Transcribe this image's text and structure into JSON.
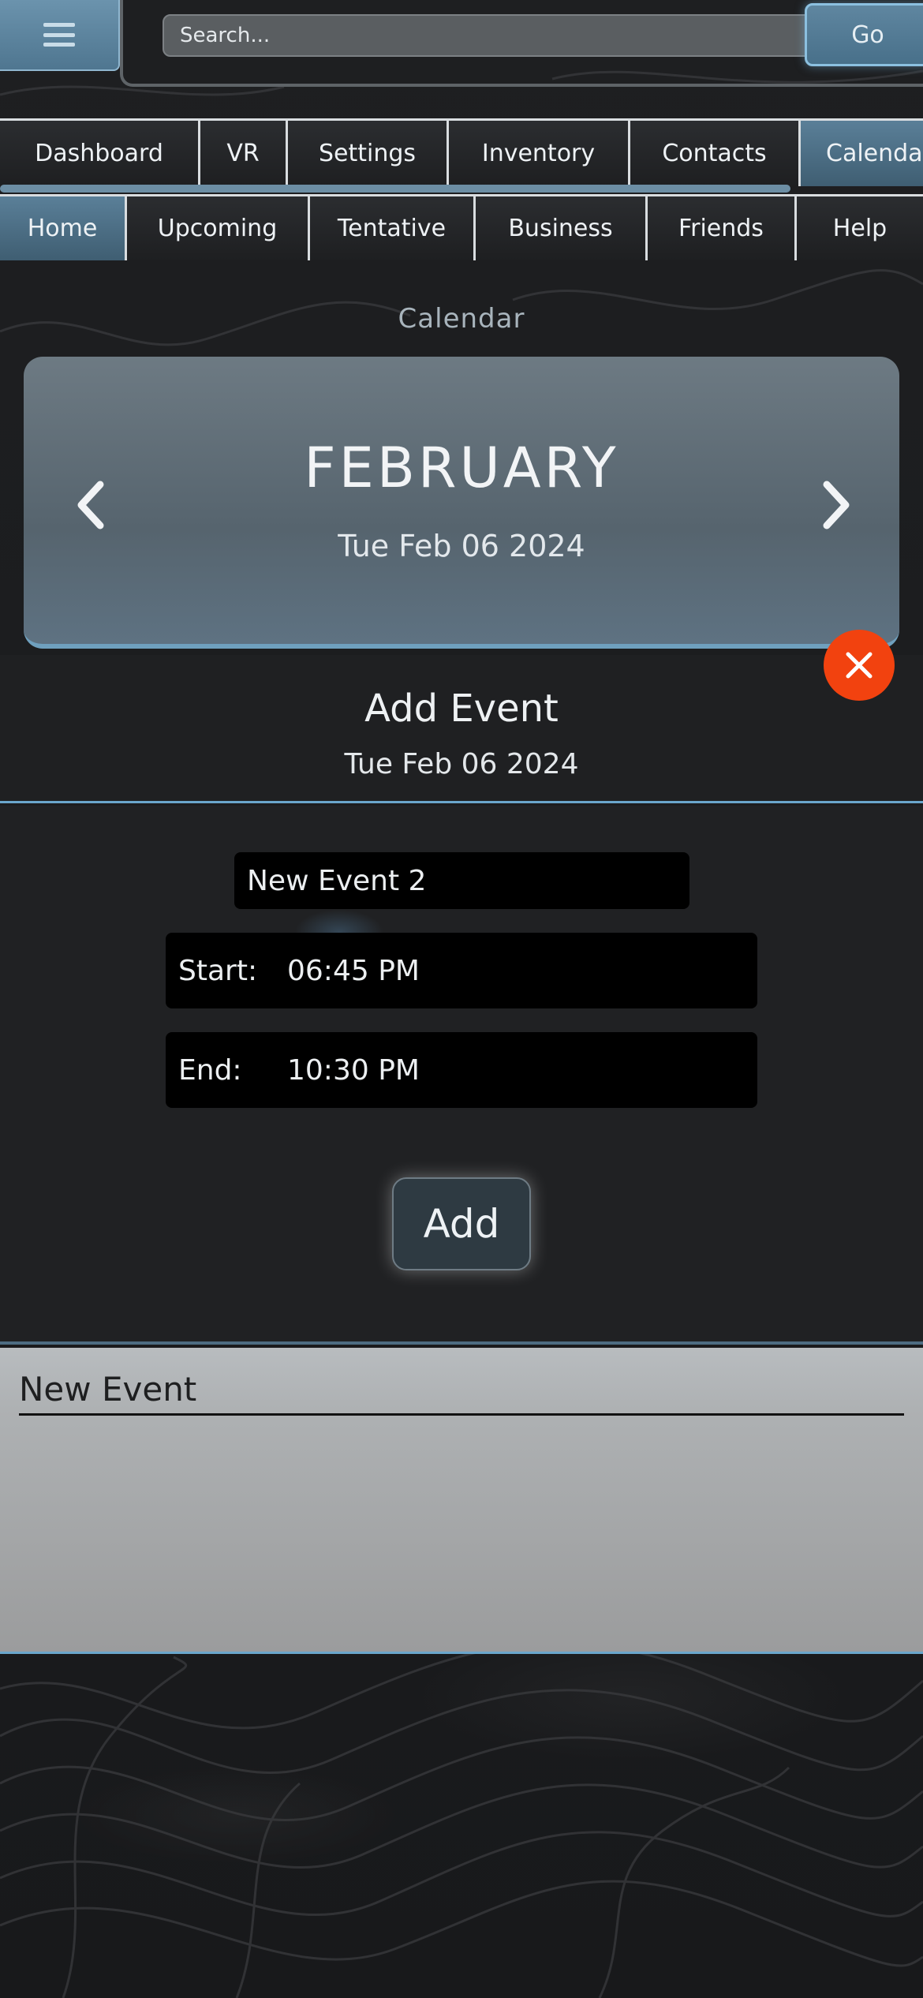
{
  "header": {
    "menu_icon": "hamburger-icon",
    "search_placeholder": "Search...",
    "go_label": "Go"
  },
  "nav_primary": [
    {
      "label": "Dashboard",
      "active": false
    },
    {
      "label": "VR",
      "active": false
    },
    {
      "label": "Settings",
      "active": false
    },
    {
      "label": "Inventory",
      "active": false
    },
    {
      "label": "Contacts",
      "active": false
    },
    {
      "label": "Calendar",
      "active": true
    }
  ],
  "nav_secondary": [
    {
      "label": "Home",
      "active": true
    },
    {
      "label": "Upcoming",
      "active": false
    },
    {
      "label": "Tentative",
      "active": false
    },
    {
      "label": "Business",
      "active": false
    },
    {
      "label": "Friends",
      "active": false
    },
    {
      "label": "Help",
      "active": false
    }
  ],
  "page": {
    "section_title": "Calendar"
  },
  "month_panel": {
    "month": "FEBRUARY",
    "date": "Tue Feb 06 2024",
    "prev_icon": "chevron-left-icon",
    "next_icon": "chevron-right-icon"
  },
  "add_event": {
    "title": "Add Event",
    "date": "Tue Feb 06 2024",
    "close_icon": "close-icon",
    "name_value": "New Event 2",
    "start_label": "Start:",
    "start_value": "06:45 PM",
    "end_label": "End:",
    "end_value": "10:30 PM",
    "add_label": "Add"
  },
  "events": {
    "items": [
      {
        "title": "New Event"
      }
    ]
  },
  "colors": {
    "accent": "#6aa6cc",
    "close": "#f2420f",
    "active_tab": "#5a7f98"
  }
}
